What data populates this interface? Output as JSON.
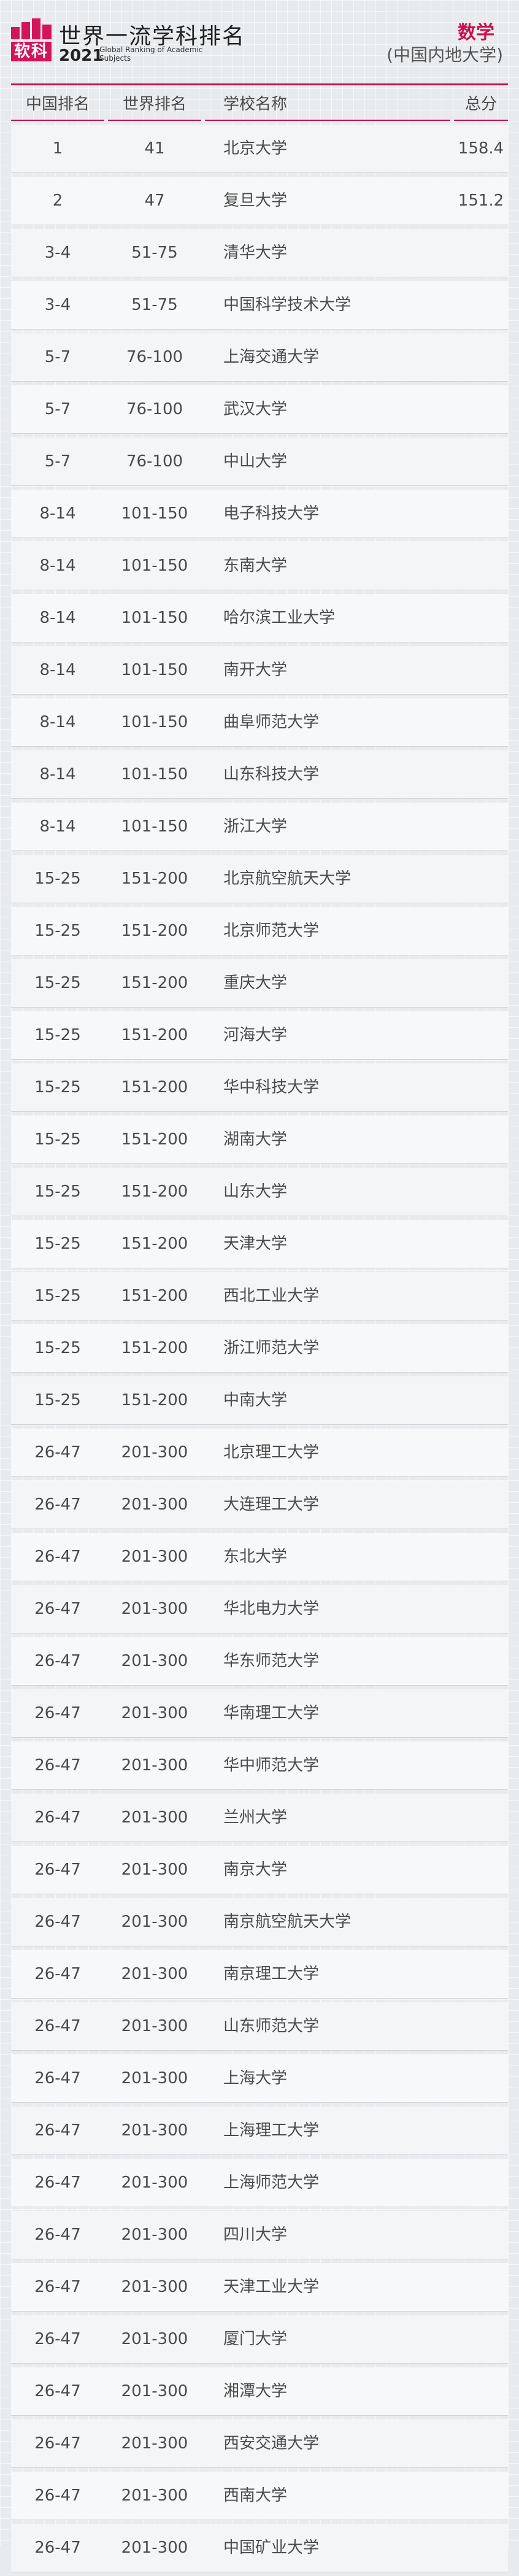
{
  "header": {
    "logo_text": "软科",
    "brand_title": "世界一流学科排名",
    "brand_year": "2021",
    "brand_en": "Global Ranking of Academic Subjects",
    "subject": "数学",
    "scope": "(中国内地大学)"
  },
  "table": {
    "columns": {
      "china_rank": "中国排名",
      "world_rank": "世界排名",
      "school": "学校名称",
      "total": "总分"
    },
    "rows": [
      {
        "china_rank": "1",
        "world_rank": "41",
        "school": "北京大学",
        "total": "158.4"
      },
      {
        "china_rank": "2",
        "world_rank": "47",
        "school": "复旦大学",
        "total": "151.2"
      },
      {
        "china_rank": "3-4",
        "world_rank": "51-75",
        "school": "清华大学",
        "total": ""
      },
      {
        "china_rank": "3-4",
        "world_rank": "51-75",
        "school": "中国科学技术大学",
        "total": ""
      },
      {
        "china_rank": "5-7",
        "world_rank": "76-100",
        "school": "上海交通大学",
        "total": ""
      },
      {
        "china_rank": "5-7",
        "world_rank": "76-100",
        "school": "武汉大学",
        "total": ""
      },
      {
        "china_rank": "5-7",
        "world_rank": "76-100",
        "school": "中山大学",
        "total": ""
      },
      {
        "china_rank": "8-14",
        "world_rank": "101-150",
        "school": "电子科技大学",
        "total": ""
      },
      {
        "china_rank": "8-14",
        "world_rank": "101-150",
        "school": "东南大学",
        "total": ""
      },
      {
        "china_rank": "8-14",
        "world_rank": "101-150",
        "school": "哈尔滨工业大学",
        "total": ""
      },
      {
        "china_rank": "8-14",
        "world_rank": "101-150",
        "school": "南开大学",
        "total": ""
      },
      {
        "china_rank": "8-14",
        "world_rank": "101-150",
        "school": "曲阜师范大学",
        "total": ""
      },
      {
        "china_rank": "8-14",
        "world_rank": "101-150",
        "school": "山东科技大学",
        "total": ""
      },
      {
        "china_rank": "8-14",
        "world_rank": "101-150",
        "school": "浙江大学",
        "total": ""
      },
      {
        "china_rank": "15-25",
        "world_rank": "151-200",
        "school": "北京航空航天大学",
        "total": ""
      },
      {
        "china_rank": "15-25",
        "world_rank": "151-200",
        "school": "北京师范大学",
        "total": ""
      },
      {
        "china_rank": "15-25",
        "world_rank": "151-200",
        "school": "重庆大学",
        "total": ""
      },
      {
        "china_rank": "15-25",
        "world_rank": "151-200",
        "school": "河海大学",
        "total": ""
      },
      {
        "china_rank": "15-25",
        "world_rank": "151-200",
        "school": "华中科技大学",
        "total": ""
      },
      {
        "china_rank": "15-25",
        "world_rank": "151-200",
        "school": "湖南大学",
        "total": ""
      },
      {
        "china_rank": "15-25",
        "world_rank": "151-200",
        "school": "山东大学",
        "total": ""
      },
      {
        "china_rank": "15-25",
        "world_rank": "151-200",
        "school": "天津大学",
        "total": ""
      },
      {
        "china_rank": "15-25",
        "world_rank": "151-200",
        "school": "西北工业大学",
        "total": ""
      },
      {
        "china_rank": "15-25",
        "world_rank": "151-200",
        "school": "浙江师范大学",
        "total": ""
      },
      {
        "china_rank": "15-25",
        "world_rank": "151-200",
        "school": "中南大学",
        "total": ""
      },
      {
        "china_rank": "26-47",
        "world_rank": "201-300",
        "school": "北京理工大学",
        "total": ""
      },
      {
        "china_rank": "26-47",
        "world_rank": "201-300",
        "school": "大连理工大学",
        "total": ""
      },
      {
        "china_rank": "26-47",
        "world_rank": "201-300",
        "school": "东北大学",
        "total": ""
      },
      {
        "china_rank": "26-47",
        "world_rank": "201-300",
        "school": "华北电力大学",
        "total": ""
      },
      {
        "china_rank": "26-47",
        "world_rank": "201-300",
        "school": "华东师范大学",
        "total": ""
      },
      {
        "china_rank": "26-47",
        "world_rank": "201-300",
        "school": "华南理工大学",
        "total": ""
      },
      {
        "china_rank": "26-47",
        "world_rank": "201-300",
        "school": "华中师范大学",
        "total": ""
      },
      {
        "china_rank": "26-47",
        "world_rank": "201-300",
        "school": "兰州大学",
        "total": ""
      },
      {
        "china_rank": "26-47",
        "world_rank": "201-300",
        "school": "南京大学",
        "total": ""
      },
      {
        "china_rank": "26-47",
        "world_rank": "201-300",
        "school": "南京航空航天大学",
        "total": ""
      },
      {
        "china_rank": "26-47",
        "world_rank": "201-300",
        "school": "南京理工大学",
        "total": ""
      },
      {
        "china_rank": "26-47",
        "world_rank": "201-300",
        "school": "山东师范大学",
        "total": ""
      },
      {
        "china_rank": "26-47",
        "world_rank": "201-300",
        "school": "上海大学",
        "total": ""
      },
      {
        "china_rank": "26-47",
        "world_rank": "201-300",
        "school": "上海理工大学",
        "total": ""
      },
      {
        "china_rank": "26-47",
        "world_rank": "201-300",
        "school": "上海师范大学",
        "total": ""
      },
      {
        "china_rank": "26-47",
        "world_rank": "201-300",
        "school": "四川大学",
        "total": ""
      },
      {
        "china_rank": "26-47",
        "world_rank": "201-300",
        "school": "天津工业大学",
        "total": ""
      },
      {
        "china_rank": "26-47",
        "world_rank": "201-300",
        "school": "厦门大学",
        "total": ""
      },
      {
        "china_rank": "26-47",
        "world_rank": "201-300",
        "school": "湘潭大学",
        "total": ""
      },
      {
        "china_rank": "26-47",
        "world_rank": "201-300",
        "school": "西安交通大学",
        "total": ""
      },
      {
        "china_rank": "26-47",
        "world_rank": "201-300",
        "school": "西南大学",
        "total": ""
      },
      {
        "china_rank": "26-47",
        "world_rank": "201-300",
        "school": "中国矿业大学",
        "total": ""
      }
    ]
  },
  "colors": {
    "accent": "#c8104e",
    "logo": "#d4145a",
    "row_bg": "#f4f5f7",
    "page_bg": "#e8ebee"
  }
}
